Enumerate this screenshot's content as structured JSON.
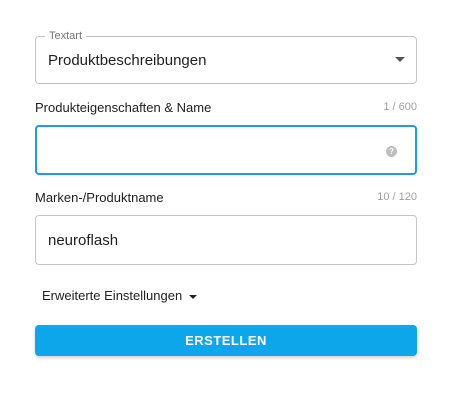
{
  "textart": {
    "label": "Textart",
    "value": "Produktbeschreibungen"
  },
  "produkteigenschaften": {
    "label": "Produkteigenschaften & Name",
    "counter": "1 / 600",
    "value": "",
    "help_glyph": "?"
  },
  "markenname": {
    "label": "Marken-/Produktname",
    "counter": "10 / 120",
    "value": "neuroflash"
  },
  "advanced": {
    "label": "Erweiterte Einstellungen"
  },
  "submit": {
    "label": "ERSTELLEN"
  },
  "colors": {
    "accent": "#0ea6ea",
    "focus_border": "#2196f3"
  },
  "icons": {
    "select_arrow": "chevron-down-icon",
    "help": "help-icon",
    "advanced_arrow": "caret-down-icon"
  }
}
